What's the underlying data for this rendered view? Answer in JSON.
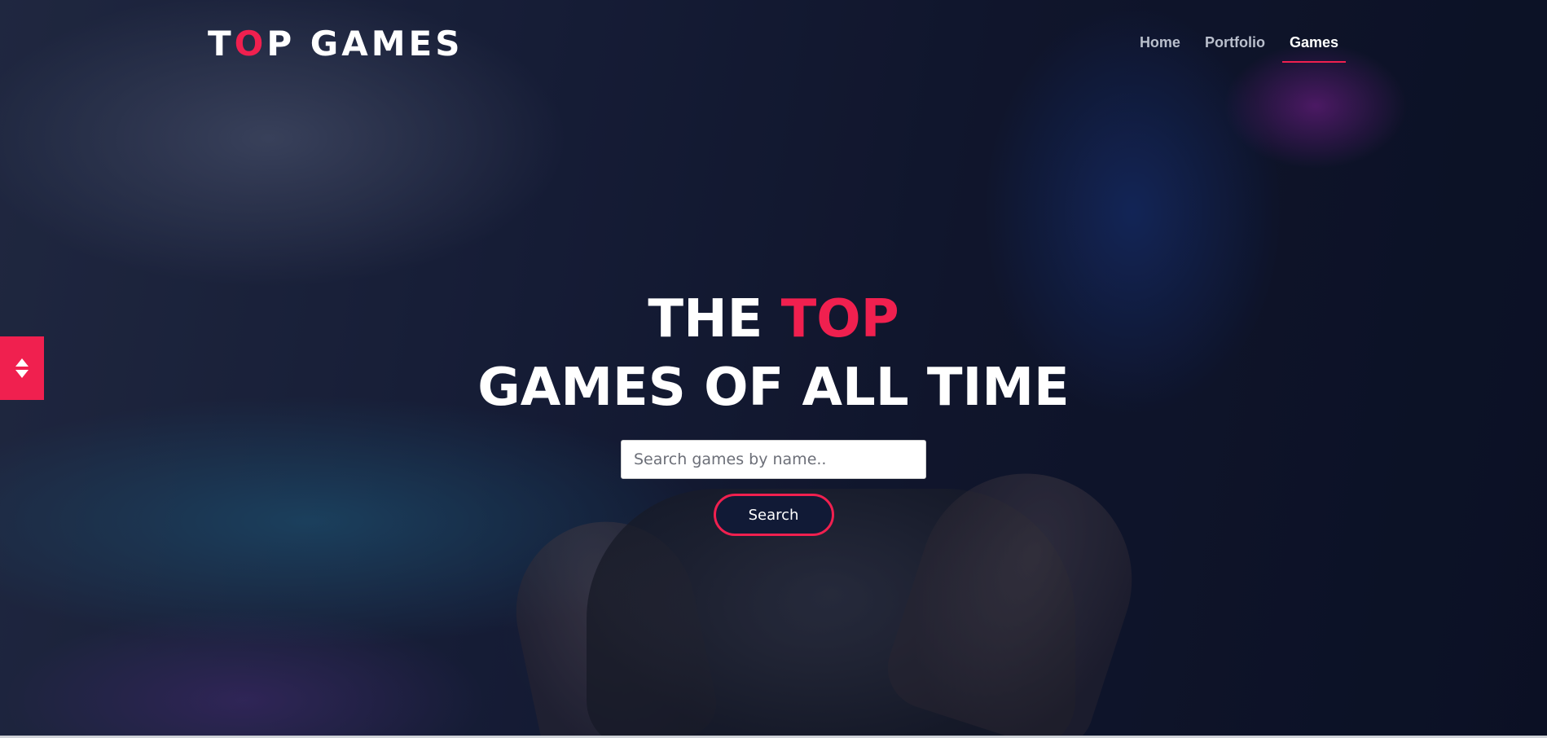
{
  "logo": {
    "part1": "T",
    "accent": "O",
    "part2": "P GAMES"
  },
  "nav": {
    "items": [
      {
        "label": "Home",
        "active": false
      },
      {
        "label": "Portfolio",
        "active": false
      },
      {
        "label": "Games",
        "active": true
      }
    ]
  },
  "hero": {
    "line1_prefix": "THE ",
    "line1_accent": "TOP",
    "line2": "GAMES OF ALL TIME"
  },
  "search": {
    "placeholder": "Search games by name..",
    "button_label": "Search"
  },
  "side_toggle": {
    "icon": "sort-up-down-icon"
  },
  "colors": {
    "accent": "#f0204f",
    "background": "#141a32",
    "button_fill": "#111a36",
    "nav_inactive": "#b9bfcc",
    "text": "#ffffff"
  }
}
